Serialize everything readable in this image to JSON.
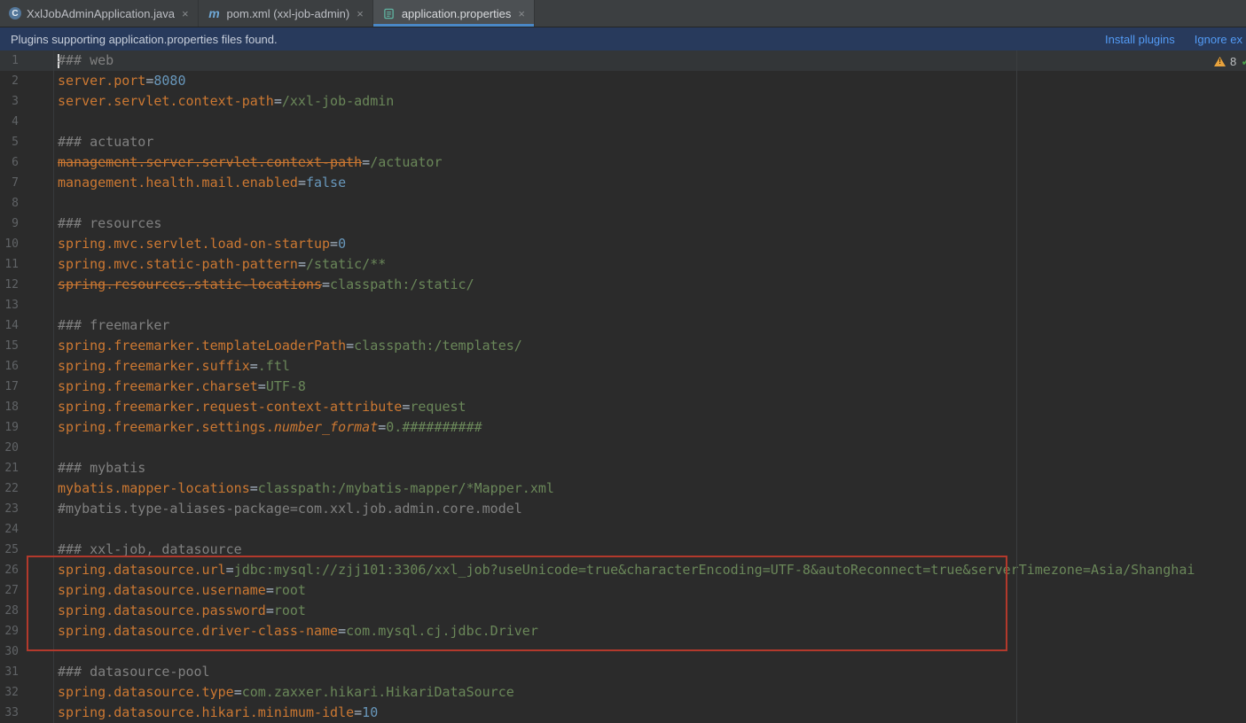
{
  "tabs": [
    {
      "label": "XxlJobAdminApplication.java",
      "icon": "java-class-icon",
      "close_label": "×",
      "active": false
    },
    {
      "label": "pom.xml (xxl-job-admin)",
      "icon": "maven-icon",
      "close_label": "×",
      "active": false
    },
    {
      "label": "application.properties",
      "icon": "properties-file-icon",
      "close_label": "×",
      "active": true
    }
  ],
  "banner": {
    "message": "Plugins supporting application.properties files found.",
    "actions": [
      {
        "label": "Install plugins"
      },
      {
        "label": "Ignore ex"
      }
    ]
  },
  "inspections": {
    "warning_count": "8",
    "warning_mark": "!",
    "check_icon": "✓"
  },
  "colors": {
    "accent_underline": "#4a88c7",
    "annotation_red": "#b3392c",
    "key_orange": "#cc7832",
    "value_green": "#6a8759",
    "number_blue": "#6897bb",
    "comment_gray": "#808080"
  },
  "editor": {
    "lines": [
      {
        "n": 1,
        "segs": [
          [
            "c",
            "### web"
          ]
        ]
      },
      {
        "n": 2,
        "segs": [
          [
            "k",
            "server.port"
          ],
          [
            "e",
            "="
          ],
          [
            "n",
            "8080"
          ]
        ]
      },
      {
        "n": 3,
        "segs": [
          [
            "k",
            "server.servlet.context-path"
          ],
          [
            "e",
            "="
          ],
          [
            "v",
            "/xxl-job-admin"
          ]
        ]
      },
      {
        "n": 4,
        "segs": []
      },
      {
        "n": 5,
        "segs": [
          [
            "c",
            "### actuator"
          ]
        ]
      },
      {
        "n": 6,
        "segs": [
          [
            "ks",
            "management.server.servlet.context-path"
          ],
          [
            "e",
            "="
          ],
          [
            "v",
            "/actuator"
          ]
        ]
      },
      {
        "n": 7,
        "segs": [
          [
            "k",
            "management.health.mail.enabled"
          ],
          [
            "e",
            "="
          ],
          [
            "n",
            "false"
          ]
        ]
      },
      {
        "n": 8,
        "segs": []
      },
      {
        "n": 9,
        "segs": [
          [
            "c",
            "### resources"
          ]
        ]
      },
      {
        "n": 10,
        "segs": [
          [
            "k",
            "spring.mvc.servlet.load-on-startup"
          ],
          [
            "e",
            "="
          ],
          [
            "n",
            "0"
          ]
        ]
      },
      {
        "n": 11,
        "segs": [
          [
            "k",
            "spring.mvc.static-path-pattern"
          ],
          [
            "e",
            "="
          ],
          [
            "v",
            "/static/**"
          ]
        ]
      },
      {
        "n": 12,
        "segs": [
          [
            "ks",
            "spring.resources.static-locations"
          ],
          [
            "e",
            "="
          ],
          [
            "v",
            "classpath:/static/"
          ]
        ]
      },
      {
        "n": 13,
        "segs": []
      },
      {
        "n": 14,
        "segs": [
          [
            "c",
            "### freemarker"
          ]
        ]
      },
      {
        "n": 15,
        "segs": [
          [
            "k",
            "spring.freemarker.templateLoaderPath"
          ],
          [
            "e",
            "="
          ],
          [
            "v",
            "classpath:/templates/"
          ]
        ]
      },
      {
        "n": 16,
        "segs": [
          [
            "k",
            "spring.freemarker.suffix"
          ],
          [
            "e",
            "="
          ],
          [
            "v",
            ".ftl"
          ]
        ]
      },
      {
        "n": 17,
        "segs": [
          [
            "k",
            "spring.freemarker.charset"
          ],
          [
            "e",
            "="
          ],
          [
            "v",
            "UTF-8"
          ]
        ]
      },
      {
        "n": 18,
        "segs": [
          [
            "k",
            "spring.freemarker.request-context-attribute"
          ],
          [
            "e",
            "="
          ],
          [
            "v",
            "request"
          ]
        ]
      },
      {
        "n": 19,
        "segs": [
          [
            "k",
            "spring.freemarker.settings."
          ],
          [
            "ki",
            "number_format"
          ],
          [
            "e",
            "="
          ],
          [
            "v",
            "0.##########"
          ]
        ]
      },
      {
        "n": 20,
        "segs": []
      },
      {
        "n": 21,
        "segs": [
          [
            "c",
            "### mybatis"
          ]
        ]
      },
      {
        "n": 22,
        "segs": [
          [
            "k",
            "mybatis.mapper-locations"
          ],
          [
            "e",
            "="
          ],
          [
            "v",
            "classpath:/mybatis-mapper/*Mapper.xml"
          ]
        ]
      },
      {
        "n": 23,
        "segs": [
          [
            "c",
            "#mybatis.type-aliases-package=com.xxl.job.admin.core.model"
          ]
        ]
      },
      {
        "n": 24,
        "segs": []
      },
      {
        "n": 25,
        "segs": [
          [
            "c",
            "### xxl-job, datasource"
          ]
        ]
      },
      {
        "n": 26,
        "segs": [
          [
            "k",
            "spring.datasource.url"
          ],
          [
            "e",
            "="
          ],
          [
            "v",
            "jdbc:mysql://zjj101:3306/xxl_job?useUnicode=true&characterEncoding=UTF-8&autoReconnect=true&serverTimezone=Asia/Shanghai"
          ]
        ]
      },
      {
        "n": 27,
        "segs": [
          [
            "k",
            "spring.datasource.username"
          ],
          [
            "e",
            "="
          ],
          [
            "v",
            "root"
          ]
        ]
      },
      {
        "n": 28,
        "segs": [
          [
            "k",
            "spring.datasource.password"
          ],
          [
            "e",
            "="
          ],
          [
            "v",
            "root"
          ]
        ]
      },
      {
        "n": 29,
        "segs": [
          [
            "k",
            "spring.datasource.driver-class-name"
          ],
          [
            "e",
            "="
          ],
          [
            "v",
            "com.mysql.cj.jdbc.Driver"
          ]
        ]
      },
      {
        "n": 30,
        "segs": []
      },
      {
        "n": 31,
        "segs": [
          [
            "c",
            "### datasource-pool"
          ]
        ]
      },
      {
        "n": 32,
        "segs": [
          [
            "k",
            "spring.datasource.type"
          ],
          [
            "e",
            "="
          ],
          [
            "v",
            "com.zaxxer.hikari.HikariDataSource"
          ]
        ]
      },
      {
        "n": 33,
        "segs": [
          [
            "k",
            "spring.datasource.hikari.minimum-idle"
          ],
          [
            "e",
            "="
          ],
          [
            "n",
            "10"
          ]
        ]
      }
    ]
  }
}
